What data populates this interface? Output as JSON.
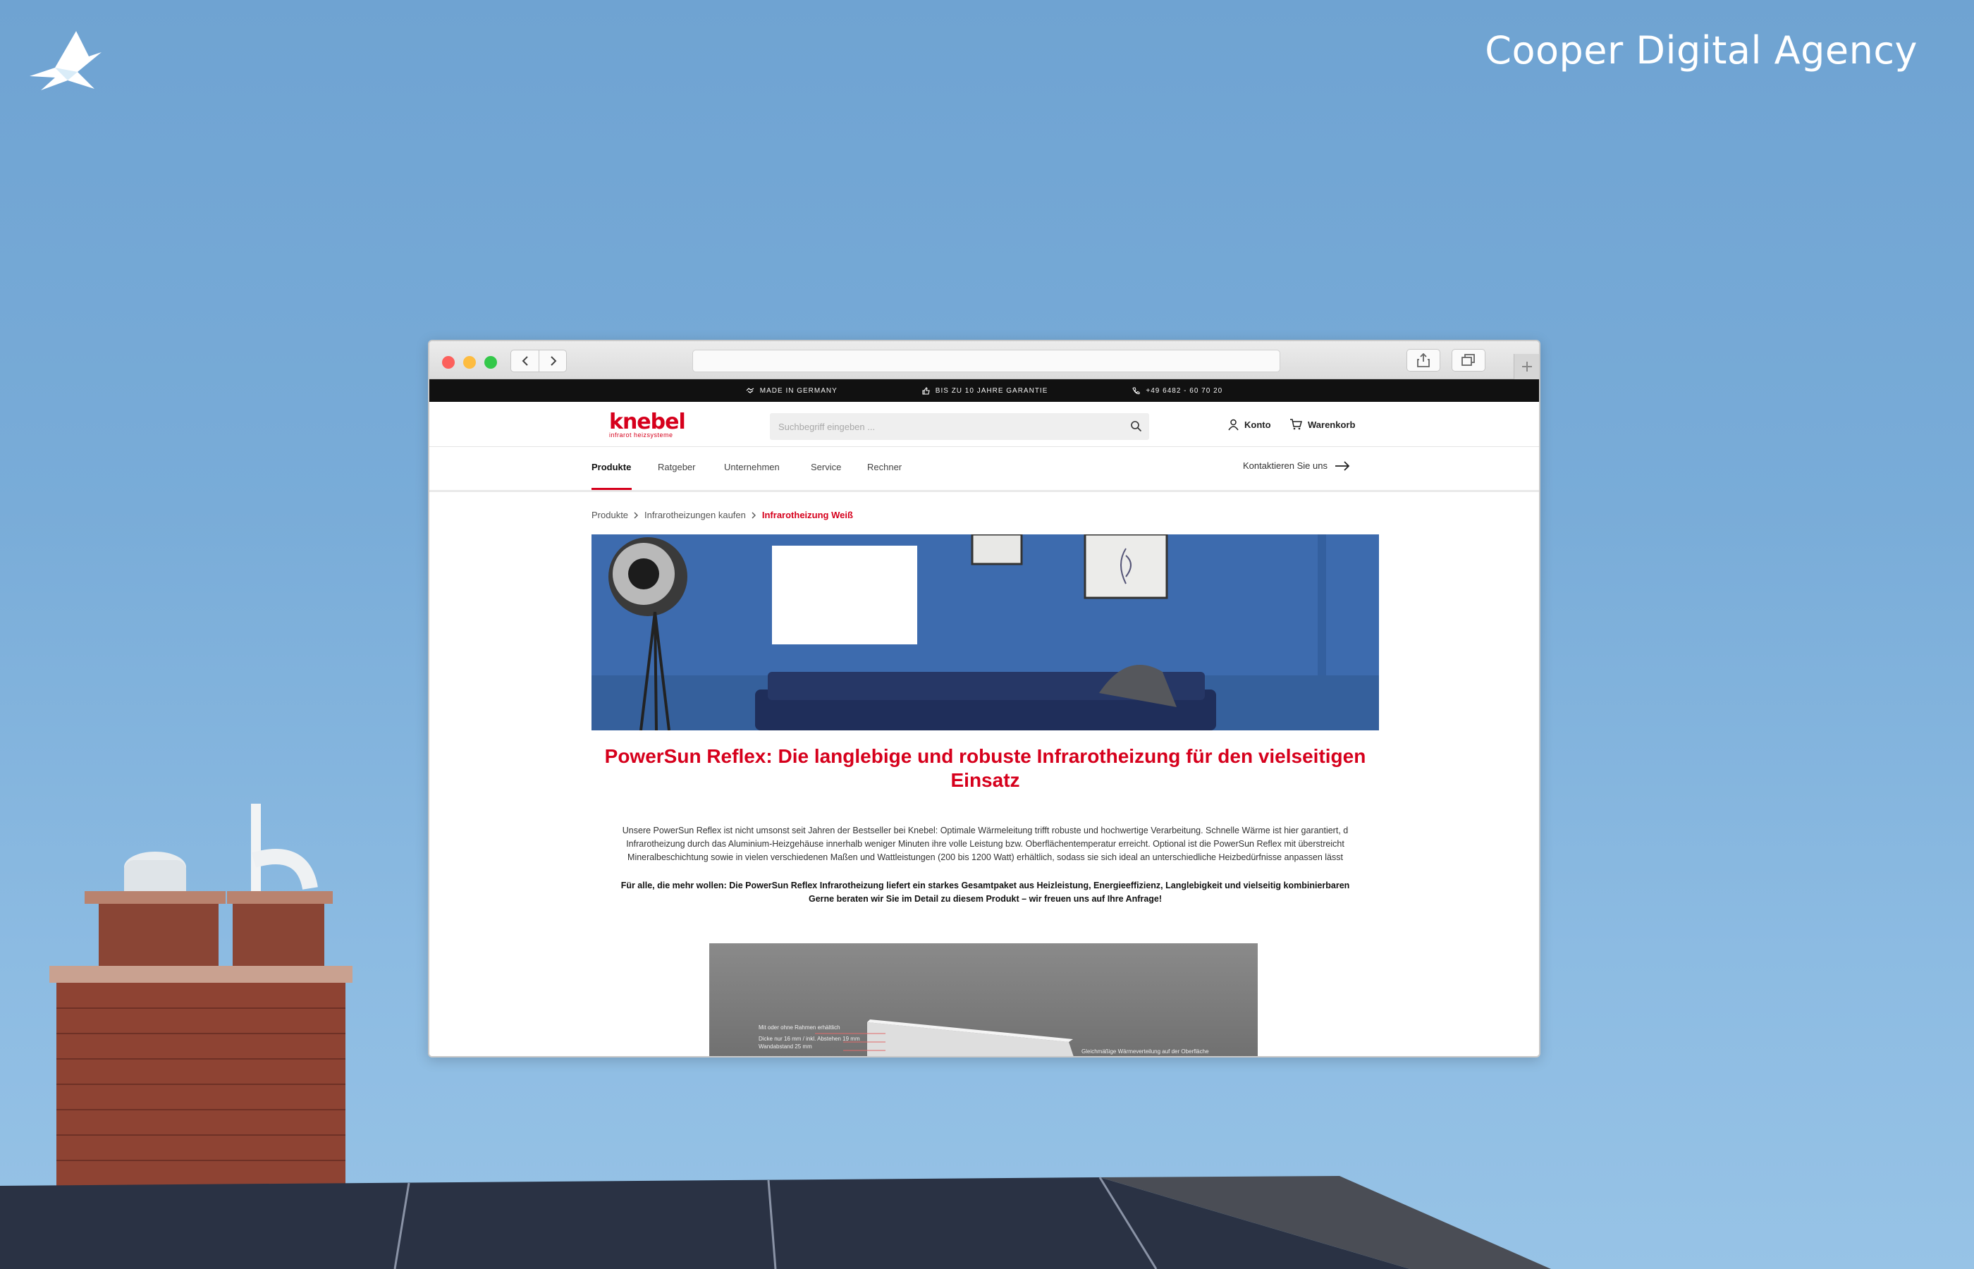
{
  "agency": {
    "name": "Cooper Digital Agency",
    "logo_icon": "bird-logo-icon"
  },
  "browser": {
    "traffic_lights": [
      "close",
      "minimize",
      "zoom"
    ],
    "url": "",
    "buttons": {
      "back": "chevron-left-icon",
      "forward": "chevron-right-icon",
      "share": "share-icon",
      "tabs": "tabs-icon",
      "new_tab": "plus-icon"
    }
  },
  "site": {
    "topbar": [
      {
        "icon": "handshake-icon",
        "text": "MADE IN GERMANY"
      },
      {
        "icon": "thumbs-up-icon",
        "text": "BIS ZU 10 JAHRE GARANTIE"
      },
      {
        "icon": "phone-icon",
        "text": "+49 6482 - 60 70 20"
      }
    ],
    "logo": {
      "word": "knebel",
      "tagline": "infrarot heizsysteme"
    },
    "search": {
      "placeholder": "Suchbegriff eingeben ..."
    },
    "account_label": "Konto",
    "cart_label": "Warenkorb",
    "nav": [
      "Produkte",
      "Ratgeber",
      "Unternehmen",
      "Service",
      "Rechner"
    ],
    "nav_active": "Produkte",
    "contact_label": "Kontaktieren Sie uns",
    "breadcrumb": [
      "Produkte",
      "Infrarotheizungen kaufen",
      "Infrarotheizung Weiß"
    ],
    "product": {
      "title": "PowerSun Reflex: Die langlebige und robuste Infrarotheizung für den vielseitigen Einsatz",
      "description": [
        "Unsere PowerSun Reflex ist nicht umsonst seit Jahren der Bestseller bei Knebel: Optimale Wärmeleitung trifft robuste und hochwertige Verarbeitung. Schnelle Wärme ist hier garantiert, d",
        "Infrarotheizung durch das Aluminium-Heizgehäuse innerhalb weniger Minuten ihre volle Leistung bzw. Oberflächentemperatur erreicht. Optional ist die PowerSun Reflex mit überstreicht",
        "Mineralbeschichtung sowie in vielen verschiedenen Maßen und Wattleistungen (200 bis 1200 Watt) erhältlich, sodass sie sich ideal an unterschiedliche Heizbedürfnisse anpassen lässt"
      ],
      "highlight": [
        "Für alle, die mehr wollen: Die PowerSun Reflex Infrarotheizung liefert ein starkes Gesamtpaket aus Heizleistung, Energieeffizienz, Langlebigkeit und vielseitig kombinierbaren",
        "Gerne beraten wir Sie im Detail zu diesem Produkt – wir freuen uns auf Ihre Anfrage!"
      ],
      "annotations": [
        "Mit oder ohne Rahmen erhältlich",
        "Dicke nur 16 mm / inkl. Abstehen 19 mm",
        "Wandabstand 25 mm",
        "Gleichmäßige Wärmeverteilung auf der Oberfläche"
      ]
    }
  }
}
